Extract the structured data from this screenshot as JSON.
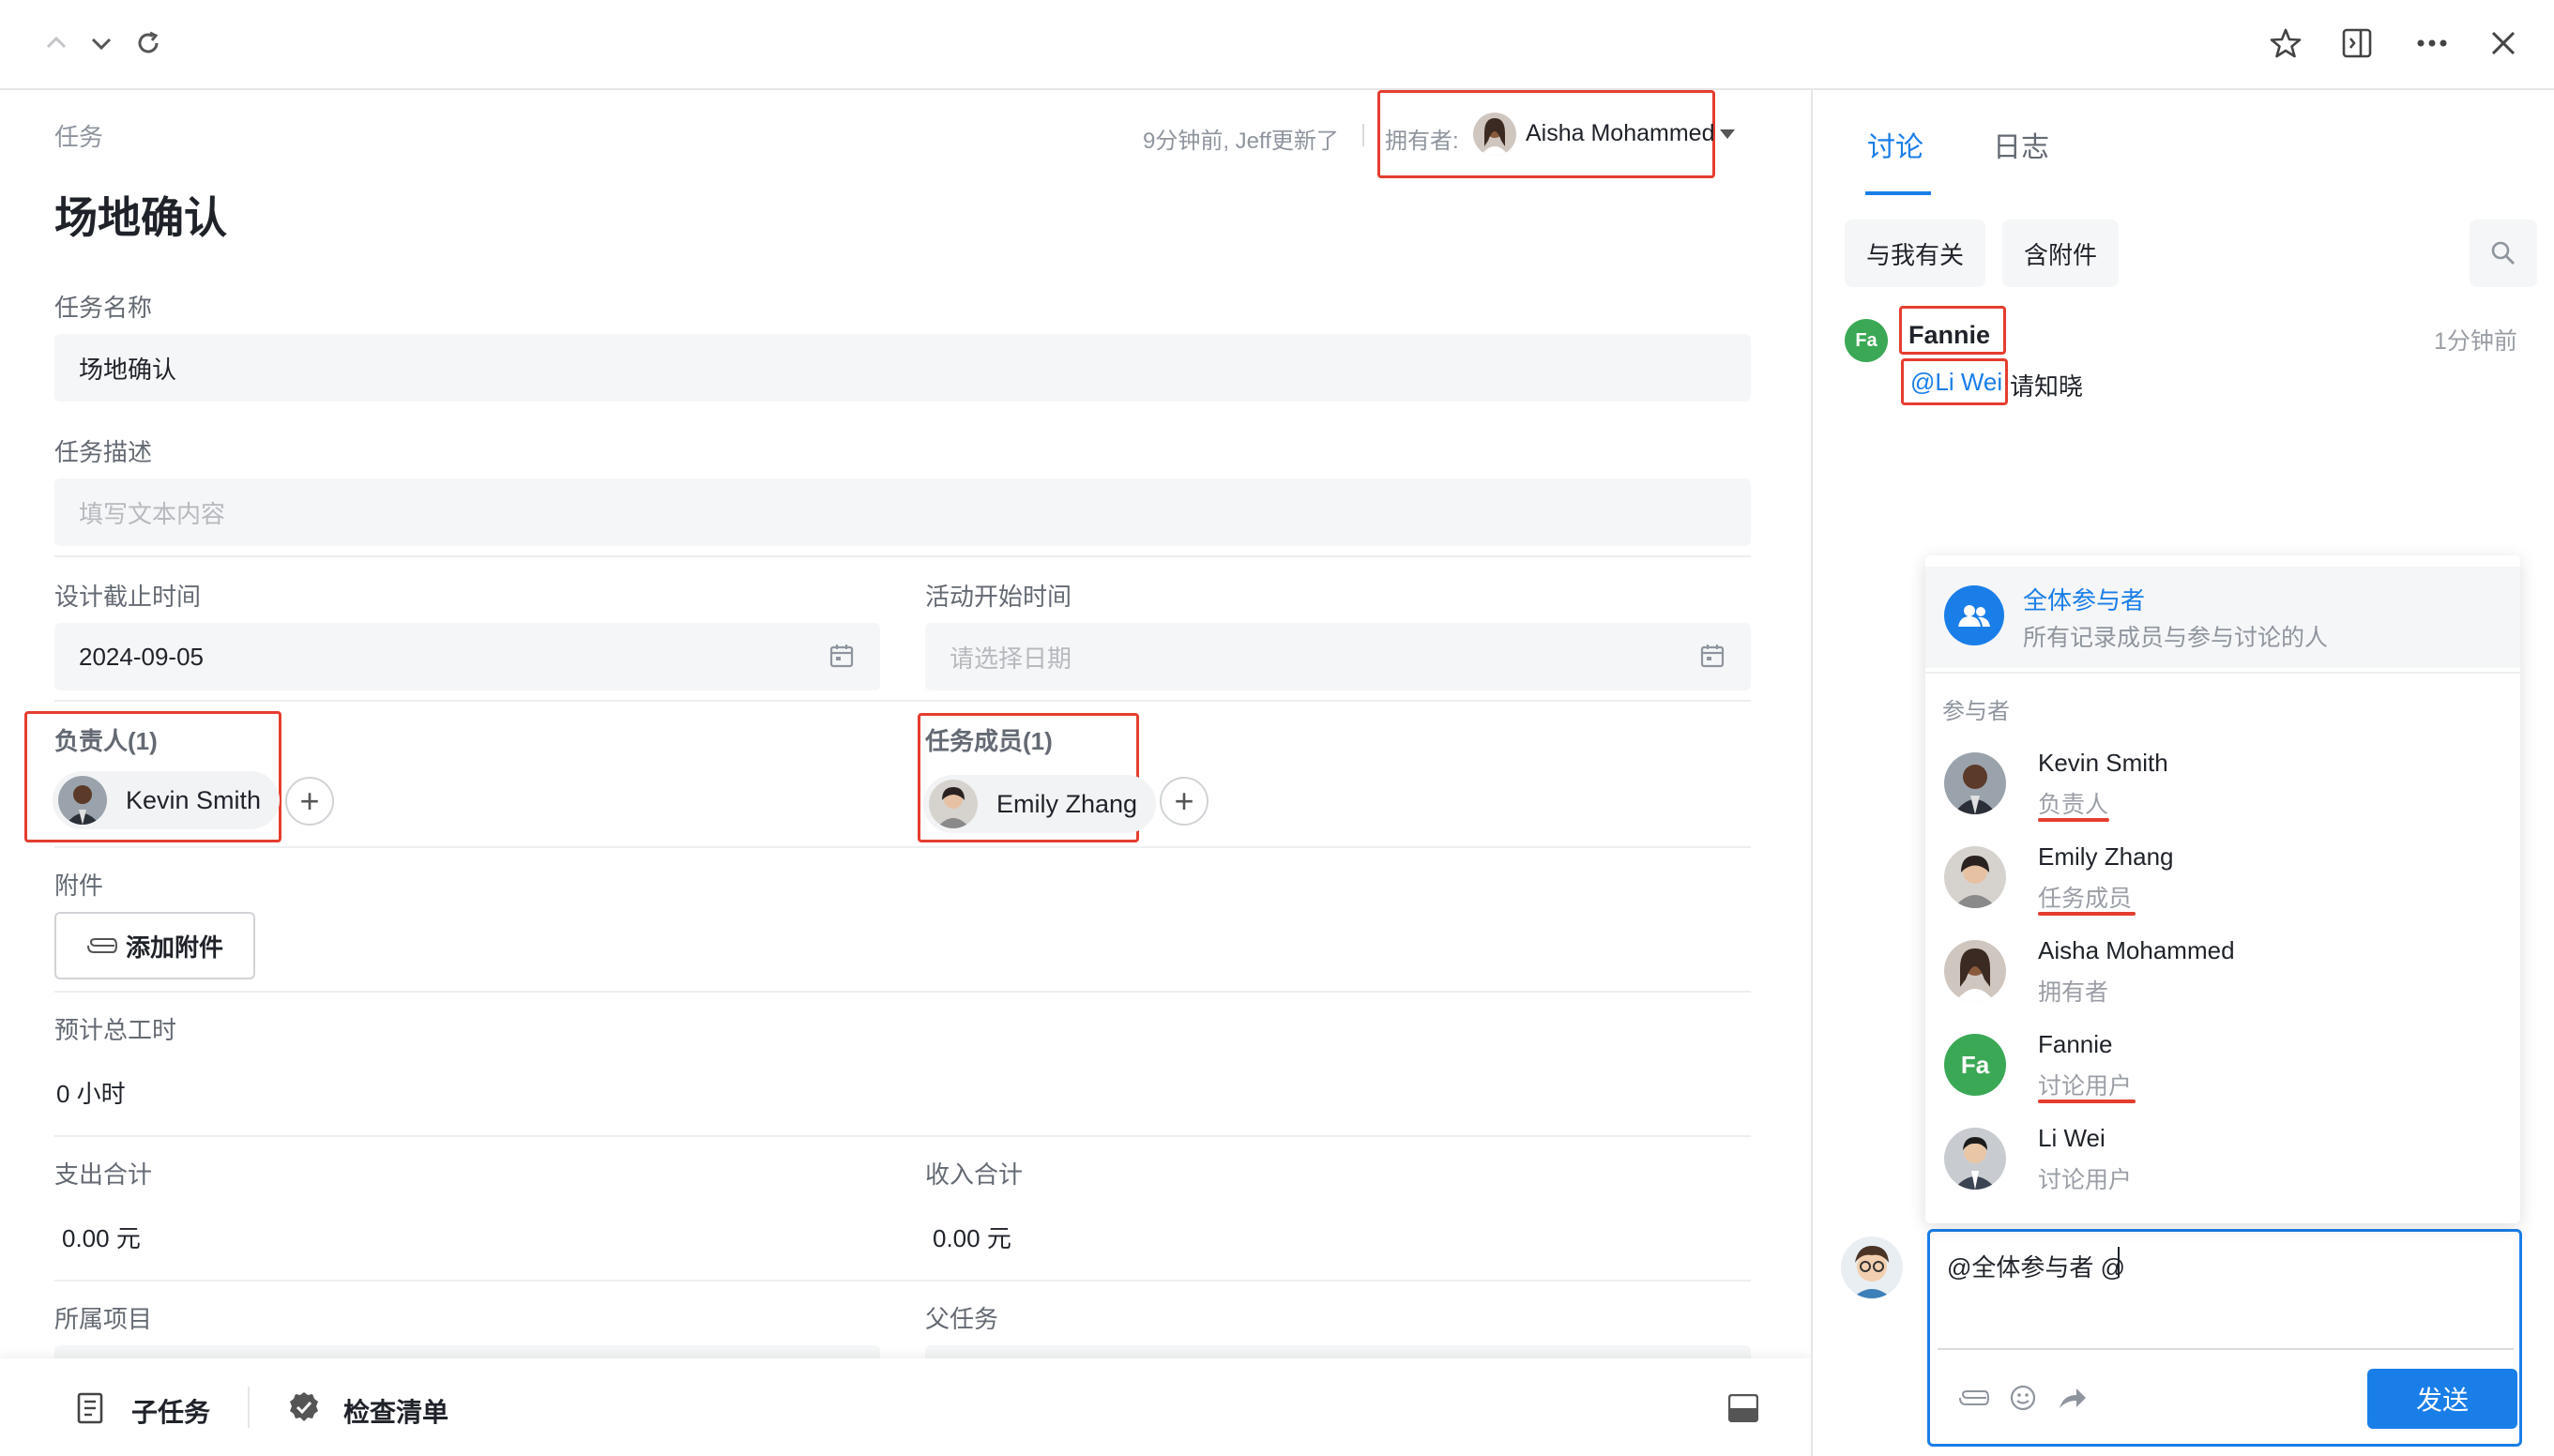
{
  "topbar": {
    "icons": [
      "chevron-up-icon",
      "chevron-down-icon",
      "refresh-icon",
      "star-icon",
      "side-panel-icon",
      "more-icon",
      "close-icon"
    ]
  },
  "task": {
    "breadcrumb": "任务",
    "updated": "9分钟前, Jeff更新了",
    "owner_label": "拥有者:",
    "owner_name": "Aisha Mohammed",
    "title": "场地确认",
    "name_label": "任务名称",
    "name_value": "场地确认",
    "desc_label": "任务描述",
    "desc_placeholder": "填写文本内容",
    "design_deadline_label": "设计截止时间",
    "design_deadline_value": "2024-09-05",
    "activity_start_label": "活动开始时间",
    "activity_start_placeholder": "请选择日期",
    "assignee_label": "负责人(1)",
    "assignee_name": "Kevin Smith",
    "members_label": "任务成员(1)",
    "member_name": "Emily Zhang",
    "attachment_label": "附件",
    "add_attachment": "添加附件",
    "hours_label": "预计总工时",
    "hours_value": "0 小时",
    "expense_label": "支出合计",
    "expense_value": "0.00 元",
    "income_label": "收入合计",
    "income_value": "0.00 元",
    "project_label": "所属项目",
    "parent_label": "父任务"
  },
  "bottom": {
    "subtask": "子任务",
    "checklist": "检查清单"
  },
  "panel": {
    "tab_discuss": "讨论",
    "tab_log": "日志",
    "filter_related": "与我有关",
    "filter_attach": "含附件",
    "comment": {
      "avatar_initials": "Fa",
      "author": "Fannie",
      "time": "1分钟前",
      "mention": "@Li Wei",
      "text": "请知晓"
    },
    "dropdown": {
      "all_title": "全体参与者",
      "all_desc": "所有记录成员与参与讨论的人",
      "section": "参与者",
      "people": [
        {
          "name": "Kevin Smith",
          "role": "负责人"
        },
        {
          "name": "Emily Zhang",
          "role": "任务成员"
        },
        {
          "name": "Aisha Mohammed",
          "role": "拥有者"
        },
        {
          "name": "Fannie",
          "role": "讨论用户",
          "initials": "Fa"
        },
        {
          "name": "Li Wei",
          "role": "讨论用户"
        }
      ]
    },
    "input_value": "@全体参与者 @",
    "send": "发送"
  },
  "colors": {
    "accent": "#1a7ee8",
    "highlight_red": "#e53d2f",
    "fannie_green": "#3ba856"
  }
}
